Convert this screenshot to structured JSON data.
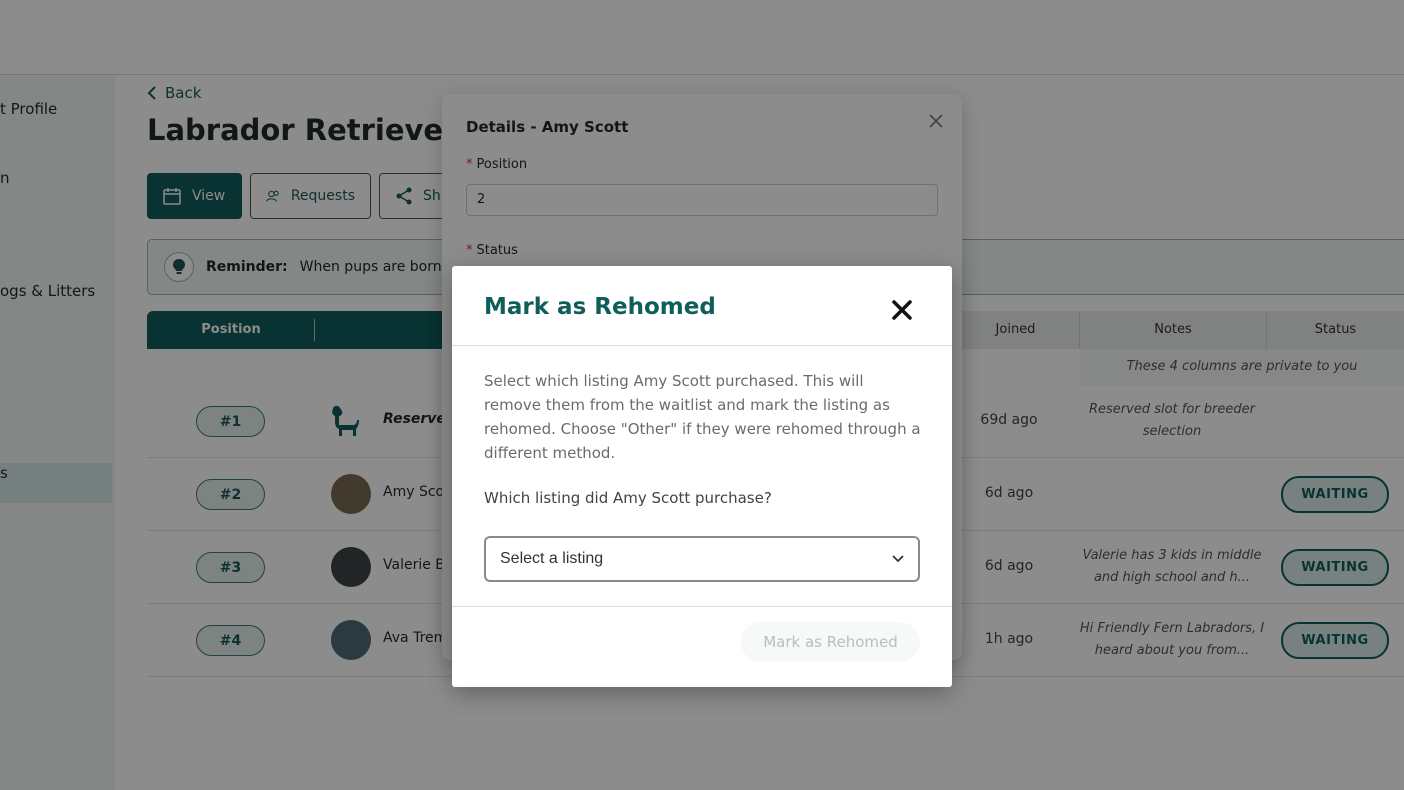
{
  "sidebar": {
    "items": [
      {
        "label": "t Profile"
      },
      {
        "label": "n"
      },
      {
        "label": "ogs & Litters"
      },
      {
        "label": "s"
      }
    ]
  },
  "header": {
    "back_label": "Back",
    "title": "Labrador Retriever"
  },
  "tabs": [
    {
      "label": "View",
      "icon": "calendar-icon"
    },
    {
      "label": "Requests",
      "icon": "users-icon"
    },
    {
      "label": "Sh",
      "icon": "share-icon"
    }
  ],
  "reminder": {
    "label": "Reminder:",
    "text": "When pups are born, u"
  },
  "table": {
    "columns": {
      "position": "Position",
      "joined": "Joined",
      "notes": "Notes",
      "status": "Status"
    },
    "private_note": "These 4 columns are private to you",
    "rows": [
      {
        "position": "#1",
        "name": "Reserved b",
        "joined": "69d ago",
        "notes": "Reserved slot for breeder selection",
        "status": ""
      },
      {
        "position": "#2",
        "name": "Amy Scot",
        "joined": "6d ago",
        "notes": "",
        "status": "WAITING"
      },
      {
        "position": "#3",
        "name": "Valerie Bu",
        "joined": "6d ago",
        "notes": "Valerie has 3 kids in middle and high school and h...",
        "status": "WAITING"
      },
      {
        "position": "#4",
        "name": "Ava Trem",
        "joined": "1h ago",
        "notes": "Hi Friendly Fern Labradors, I heard about you from...",
        "status": "WAITING"
      }
    ]
  },
  "details_modal": {
    "title": "Details - Amy Scott",
    "position_label": "Position",
    "position_value": "2",
    "status_label": "Status"
  },
  "rehome_modal": {
    "title": "Mark as Rehomed",
    "description": "Select which listing Amy Scott purchased. This will remove them from the waitlist and mark the listing as rehomed. Choose \"Other\" if they were rehomed through a different method.",
    "question": "Which listing did Amy Scott purchase?",
    "select_value": "Select a listing",
    "submit_label": "Mark as Rehomed"
  },
  "colors": {
    "brand": "#0f5e5b",
    "overlay": "rgba(0,0,0,0.45)"
  }
}
